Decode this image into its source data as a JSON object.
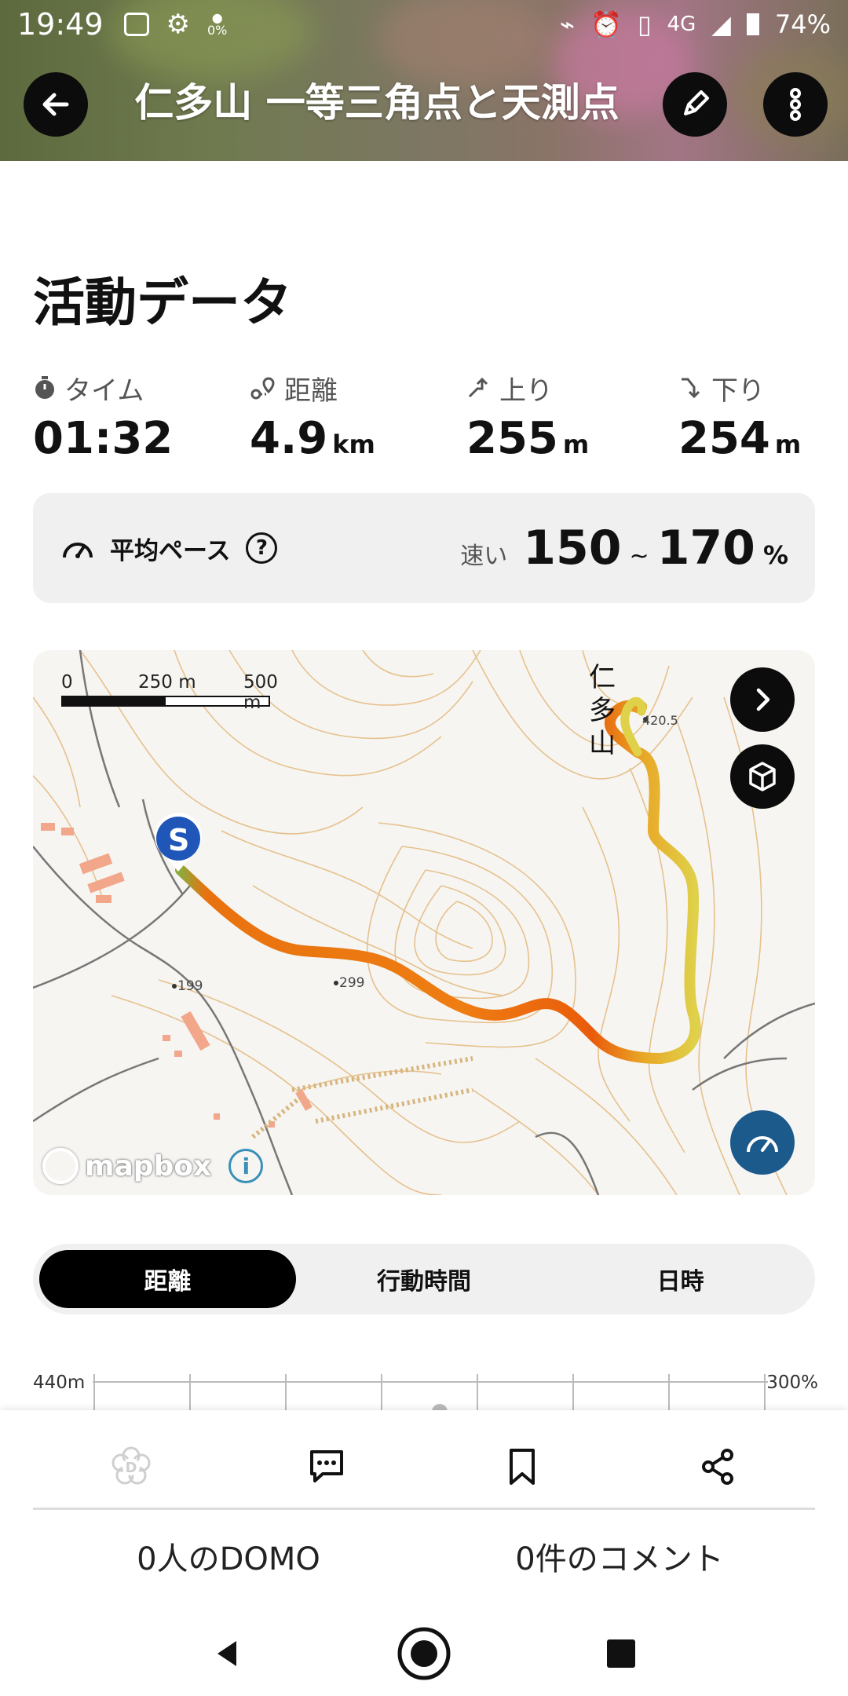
{
  "status_bar": {
    "time": "19:49",
    "network": "4G",
    "battery": "74%",
    "data_saver": "0%"
  },
  "header": {
    "title": "仁多山 一等三角点と天測点",
    "icons": [
      "back-arrow-icon",
      "pencil-icon",
      "more-vertical-icon"
    ]
  },
  "activity": {
    "section_title": "活動データ",
    "stats": [
      {
        "label": "タイム",
        "value": "01:32",
        "unit": "",
        "icon": "stopwatch-icon"
      },
      {
        "label": "距離",
        "value": "4.9",
        "unit": "km",
        "icon": "route-icon"
      },
      {
        "label": "上り",
        "value": "255",
        "unit": "m",
        "icon": "ascent-icon"
      },
      {
        "label": "下り",
        "value": "254",
        "unit": "m",
        "icon": "descent-icon"
      }
    ],
    "pace": {
      "label": "平均ペース",
      "speed_word": "速い",
      "min": "150",
      "tilde": "~",
      "max": "170",
      "unit": "%"
    }
  },
  "map": {
    "scale_labels": [
      "0",
      "250 m",
      "500 m"
    ],
    "mountain_name": [
      "仁",
      "多",
      "山"
    ],
    "elevations": [
      "420.5",
      "299",
      "199"
    ],
    "start_marker": "S",
    "attribution": "mapbox",
    "info": "i",
    "colors": {
      "route_start": "#e96a0a",
      "route_end": "#e3c33a",
      "marker": "#1f56b8",
      "gauge": "#1d5a8c"
    }
  },
  "tabs": {
    "items": [
      "距離",
      "行動時間",
      "日時"
    ],
    "active_index": 0
  },
  "chart": {
    "y_left_max": "440m",
    "y_right_max": "300%"
  },
  "social": {
    "domo_count": "0人のDOMO",
    "comment_count": "0件のコメント"
  }
}
